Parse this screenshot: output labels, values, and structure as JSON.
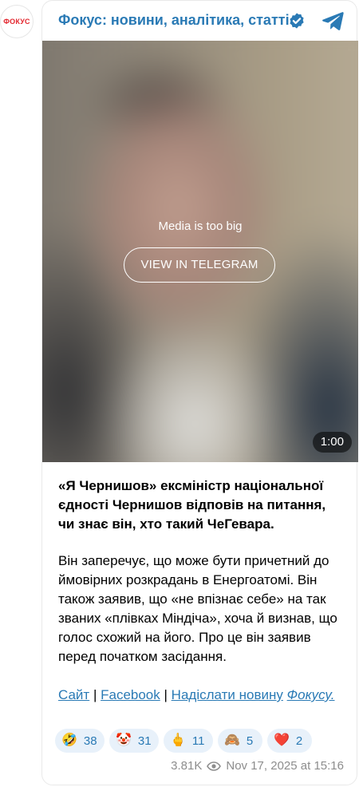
{
  "channel": {
    "avatar_text": "ФОКУС",
    "name": "Фокус: новини, аналітика, статті",
    "accent_color": "#2a7ab5",
    "verified_icon": "verified-badge-icon",
    "app_icon": "telegram-icon"
  },
  "media": {
    "notice": "Media is too big",
    "button_label": "VIEW IN TELEGRAM",
    "duration": "1:00"
  },
  "post": {
    "lead": "«Я Чернишов» ексміністр національної єдності Чернишов відповів на питання, чи знає він, хто такий ЧеГевара.",
    "body": "Він заперечує, що може бути причетний до ймовірних розкрадань в Енергоатомі. Він також заявив, що «не впізнає себе» на так званих «плівках Міндіча», хоча й визнав, що голос схожий на його. Про це він заявив перед початком засідання.",
    "links": {
      "site": "Сайт",
      "sep1": "|",
      "facebook": "Facebook",
      "sep2": "|",
      "send_news": "Надіслати новину",
      "brand": "Фокусу."
    }
  },
  "reactions": [
    {
      "emoji": "🤣",
      "count": "38"
    },
    {
      "emoji": "🤡",
      "count": "31"
    },
    {
      "emoji": "🖕",
      "count": "11"
    },
    {
      "emoji": "🙈",
      "count": "5"
    },
    {
      "emoji": "❤️",
      "count": "2"
    }
  ],
  "meta": {
    "views": "3.81K",
    "timestamp": "Nov 17, 2025 at 15:16"
  }
}
